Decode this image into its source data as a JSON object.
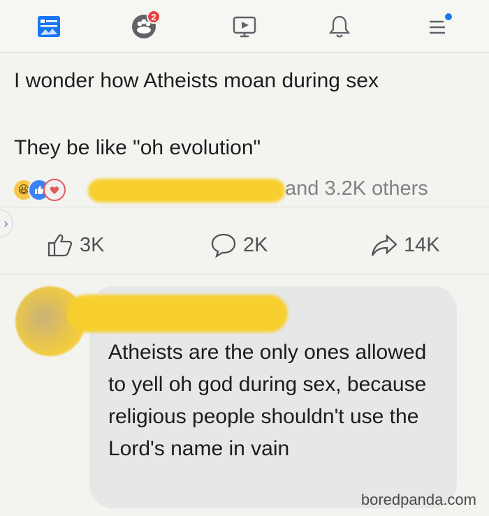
{
  "post": {
    "line1": "I wonder how Atheists moan during sex",
    "line2": "They be like \"oh evolution\""
  },
  "nav": {
    "friends_badge": "2",
    "icons": [
      "news-feed-icon",
      "friends-icon",
      "watch-icon",
      "notifications-icon",
      "menu-icon"
    ]
  },
  "reactions": {
    "icons": [
      "haha-reaction-icon",
      "like-reaction-icon",
      "love-reaction-icon"
    ],
    "count_text": "and 3.2K others"
  },
  "actions": {
    "likes": "3K",
    "comments": "2K",
    "shares": "14K"
  },
  "comment": {
    "text": "Atheists are the only ones allowed to yell oh god during sex, because religious people shouldn't use the Lord's name in vain"
  },
  "watermark": "boredpanda.com",
  "colors": {
    "accent": "#1877f2",
    "badge": "#e9413e",
    "redaction": "#f7cf2e",
    "bubble": "#e6e7e7"
  }
}
